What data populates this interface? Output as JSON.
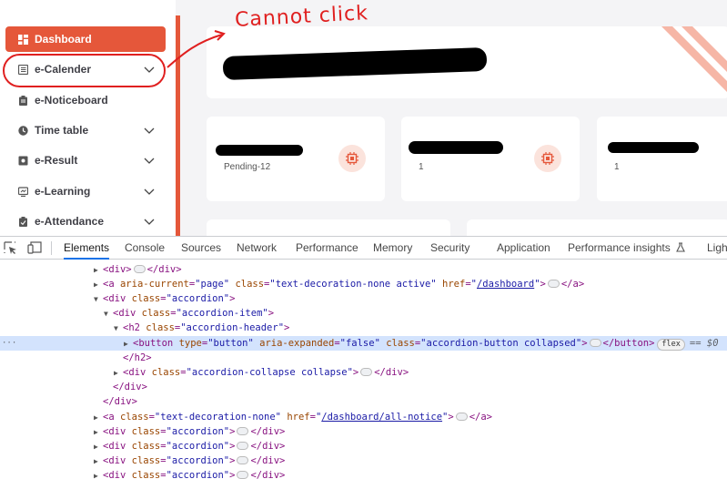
{
  "sidebar": {
    "items": [
      {
        "label": "Dashboard",
        "icon": "dashboard-grid-icon",
        "has_chevron": false,
        "active": true
      },
      {
        "label": "e-Calender",
        "icon": "calendar-list-icon",
        "has_chevron": true,
        "active": false
      },
      {
        "label": "e-Noticeboard",
        "icon": "clipboard-icon",
        "has_chevron": false,
        "active": false
      },
      {
        "label": "Time table",
        "icon": "clock-icon",
        "has_chevron": true,
        "active": false
      },
      {
        "label": "e-Result",
        "icon": "result-icon",
        "has_chevron": true,
        "active": false
      },
      {
        "label": "e-Learning",
        "icon": "learning-icon",
        "has_chevron": true,
        "active": false
      },
      {
        "label": "e-Attendance",
        "icon": "attendance-icon",
        "has_chevron": true,
        "active": false
      }
    ]
  },
  "annotation": {
    "text": "Cannot click"
  },
  "stats": [
    {
      "sub": "Pending-12"
    },
    {
      "sub": "1"
    },
    {
      "sub": "1"
    }
  ],
  "colors": {
    "accent": "#e5573a",
    "annotation": "#e02020",
    "selected_row": "#d3e3fd"
  },
  "devtools": {
    "tabs": [
      "Elements",
      "Console",
      "Sources",
      "Network",
      "Performance",
      "Memory",
      "Security",
      "Application",
      "Performance insights",
      "Ligh"
    ],
    "active_tab": "Elements",
    "selected_suffix": "== $0",
    "flex_badge": "flex"
  }
}
